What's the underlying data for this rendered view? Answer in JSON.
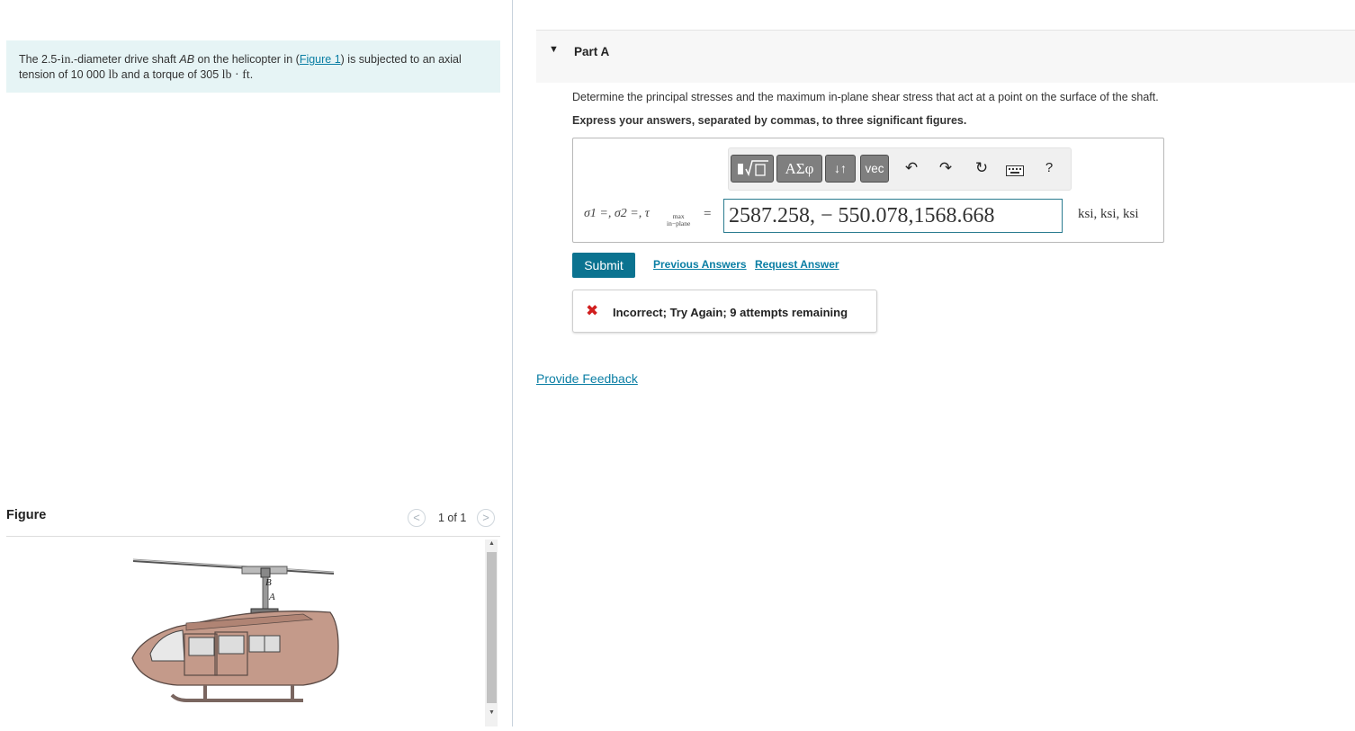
{
  "problem": {
    "text_1": "The 2.5-",
    "unit_in": "in.",
    "text_2": "-diameter drive shaft ",
    "shaft_name": "AB",
    "text_3": " on the helicopter in (",
    "figure_link": "Figure 1",
    "text_4": ") is subjected to an axial tension of 10 000 ",
    "unit_lb": "lb",
    "text_5": " and a torque of 305 ",
    "unit_lbft": "lb · ft",
    "text_6": "."
  },
  "figure": {
    "title": "Figure",
    "prev_label": "<",
    "next_label": ">",
    "counter": "1 of 1",
    "label_b": "B",
    "label_a": "A"
  },
  "part": {
    "title": "Part A",
    "question": "Determine the principal stresses and the maximum in-plane shear stress that act at a point on the surface of the shaft.",
    "instruction": "Express your answers, separated by commas, to three significant figures."
  },
  "toolbar": {
    "templates_icon": "templates-icon",
    "greek_label": "ΑΣφ",
    "arrows_label": "↓↑",
    "vec_label": "vec",
    "undo_icon": "↶",
    "redo_icon": "↷",
    "reset_icon": "↻",
    "keyboard_icon": "keyboard-icon",
    "help_label": "?"
  },
  "answer": {
    "label": "σ1 =, σ2 =, τ",
    "tau_sub_top": "max",
    "tau_sub_bottom": "in−plane",
    "equals": "=",
    "value": "2587.258, − 550.078,1568.668",
    "units": "ksi, ksi, ksi"
  },
  "actions": {
    "submit": "Submit",
    "previous_answers": "Previous Answers",
    "request_answer": "Request Answer"
  },
  "feedback": {
    "icon": "✖",
    "text": "Incorrect; Try Again; 9 attempts remaining",
    "status_color": "#d11f1f"
  },
  "provide_feedback": "Provide Feedback"
}
